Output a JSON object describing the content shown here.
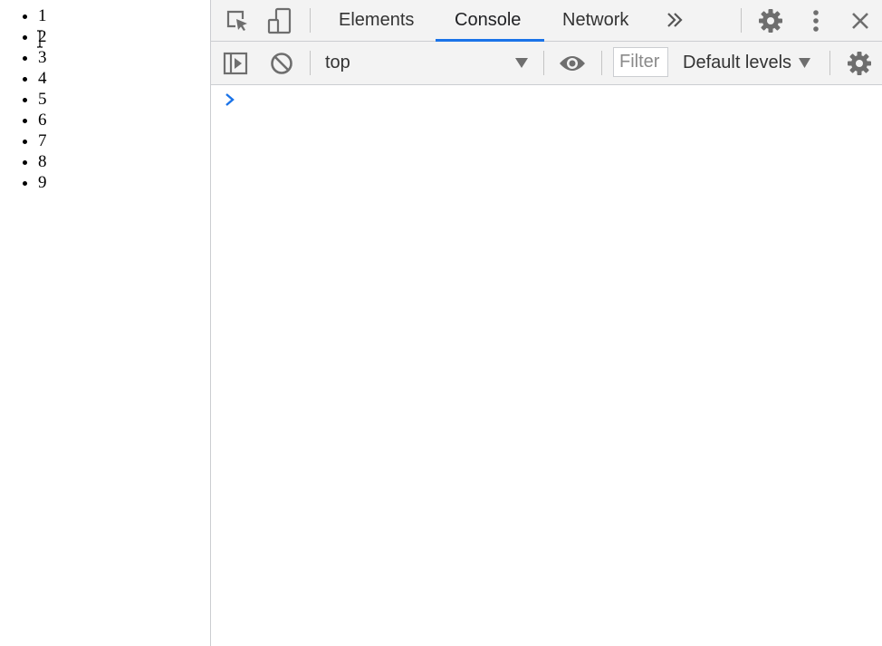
{
  "page": {
    "list_items": [
      "1",
      "2",
      "3",
      "4",
      "5",
      "6",
      "7",
      "8",
      "9"
    ]
  },
  "devtools": {
    "tabs": [
      {
        "label": "Elements"
      },
      {
        "label": "Console"
      },
      {
        "label": "Network"
      }
    ],
    "active_tab": "Console",
    "more_tabs_icon": "chevron-double-right-icon",
    "toolbar": {
      "inspect_icon": "inspect-element-icon",
      "device_icon": "device-toolbar-icon",
      "settings_icon": "gear-icon",
      "menu_icon": "vertical-dots-icon",
      "close_icon": "close-icon"
    },
    "console": {
      "sidebar_icon": "show-sidebar-icon",
      "clear_icon": "clear-console-icon",
      "context": "top",
      "eye_icon": "eye-icon",
      "filter_placeholder": "Filter",
      "filter_value": "",
      "levels_label": "Default levels",
      "settings_icon": "gear-icon",
      "prompt_icon": "prompt-chevron-icon"
    }
  },
  "colors": {
    "accent": "#1a73e8",
    "toolbar_bg": "#f3f3f3",
    "icon": "#6e6e6e",
    "border": "#cbcdd1"
  }
}
